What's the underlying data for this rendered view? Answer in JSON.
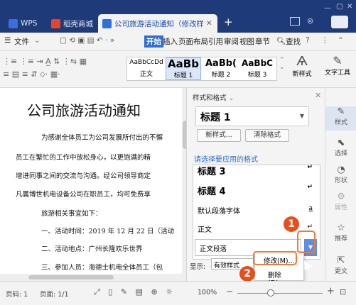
{
  "tabs": {
    "wps": "WPS",
    "shop": "稻壳商城",
    "doc": "公司旅游活动通知（修改样式）"
  },
  "menu": {
    "file": "文件",
    "start": "开始",
    "insert": "插入",
    "layout": "页面布局",
    "references": "引用",
    "review": "审阅",
    "view": "视图",
    "chapter": "章节",
    "search": "查找"
  },
  "ribbon": {
    "style_sample_1": "AaBbCcDd",
    "style_sample_2": "AaBb",
    "style_sample_3": "AaBb(",
    "style_sample_4": "AaBbC",
    "style_name_1": "正文",
    "style_name_2": "标题 1",
    "style_name_3": "标题 2",
    "style_name_4": "标题 3",
    "new_style": "新样式",
    "text_tools": "文字工具"
  },
  "document": {
    "title": "公司旅游活动通知",
    "lines": [
      "为感谢全体员工为公司发展所付出的不懈",
      "员工在繁忙的工作中放松身心，以更饱满的精",
      "增进同事之间的交流与沟通。经公司领导商定",
      "凡属博世机电设备公司在职员工，均可免费享",
      "旅游相关事宜如下：",
      "一、活动时间：2019 年 12 月 22 日（活动",
      "二、活动地点：广州长隆欢乐世界",
      "三、参加人员：海德士机电全体员工（包"
    ]
  },
  "pane": {
    "title": "样式和格式",
    "current_style": "标题 1",
    "new_style_btn": "新样式...",
    "clear_format_btn": "清除格式",
    "apply_label": "请选择要应用的格式",
    "list": [
      "标题 3",
      "标题 4",
      "默认段落字体",
      "正文",
      "正文段落"
    ],
    "show_label": "显示:",
    "show_value": "有效样式",
    "menu_modify": "修改(M)...",
    "menu_delete": "删除(D)..."
  },
  "rightbar": {
    "style": "样式",
    "select": "选择",
    "shape": "形状",
    "property": "属性",
    "recommend": "推荐",
    "more": "更文"
  },
  "status": {
    "page": "页码: 1",
    "pages": "页面: 1/1",
    "zoom": "100%"
  },
  "badges": {
    "one": "1",
    "two": "2"
  },
  "colors": {
    "titlebar": "#1f3a78",
    "accent": "#2f6fd6",
    "badge": "#e84d1c"
  }
}
